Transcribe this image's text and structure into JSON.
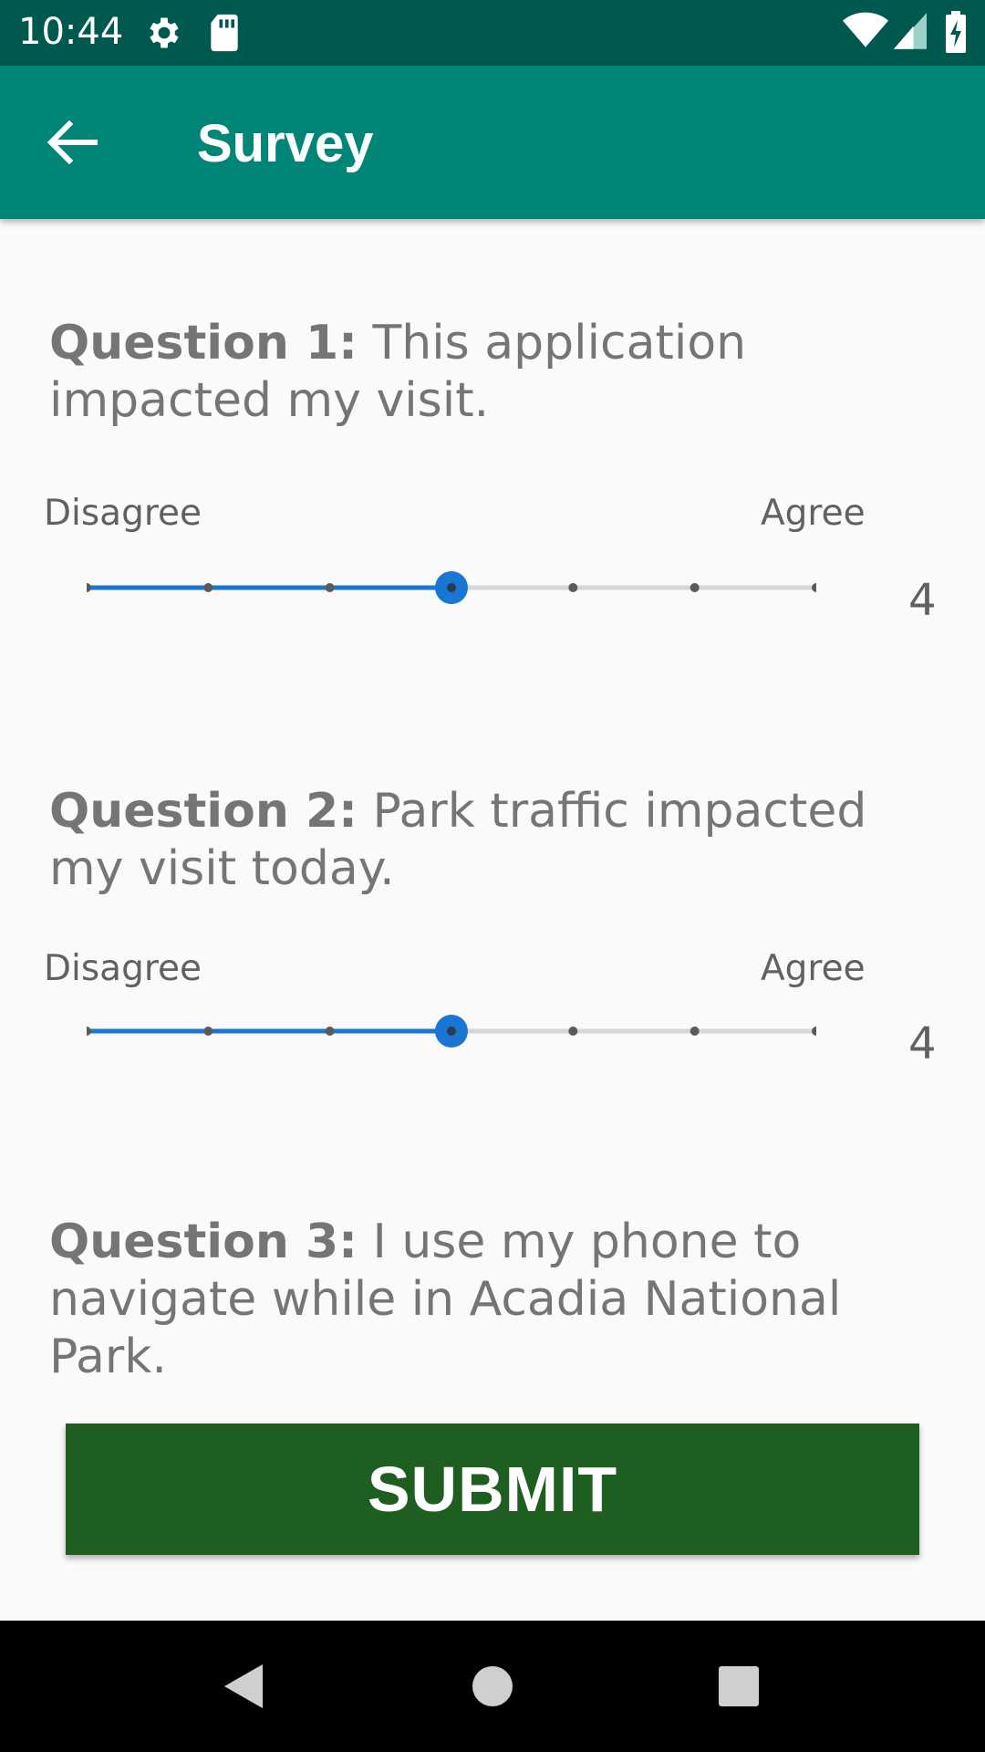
{
  "status_bar": {
    "time": "10:44",
    "icons": [
      "gear-icon",
      "sd-card-icon",
      "wifi-icon",
      "signal-icon",
      "battery-charging-icon"
    ]
  },
  "app_bar": {
    "title": "Survey",
    "back_icon": "arrow-back-icon"
  },
  "questions": [
    {
      "label": "Question 1:",
      "text": " This application impacted my visit.",
      "scale_min_label": "Disagree",
      "scale_max_label": "Agree",
      "value": "4",
      "min": 1,
      "max": 7,
      "selected": 4
    },
    {
      "label": "Question 2:",
      "text": " Park traffic impacted my visit today.",
      "scale_min_label": "Disagree",
      "scale_max_label": "Agree",
      "value": "4",
      "min": 1,
      "max": 7,
      "selected": 4
    },
    {
      "label": "Question 3:",
      "text": " I use my phone to navigate while in Acadia National Park."
    }
  ],
  "submit_label": "SUBMIT",
  "colors": {
    "status_bar": "#00594f",
    "app_bar": "#008577",
    "slider_active": "#1976d2",
    "submit_button": "#1e5e20"
  },
  "nav_bar": {
    "icons": [
      "back-triangle-icon",
      "home-circle-icon",
      "recents-square-icon"
    ]
  }
}
